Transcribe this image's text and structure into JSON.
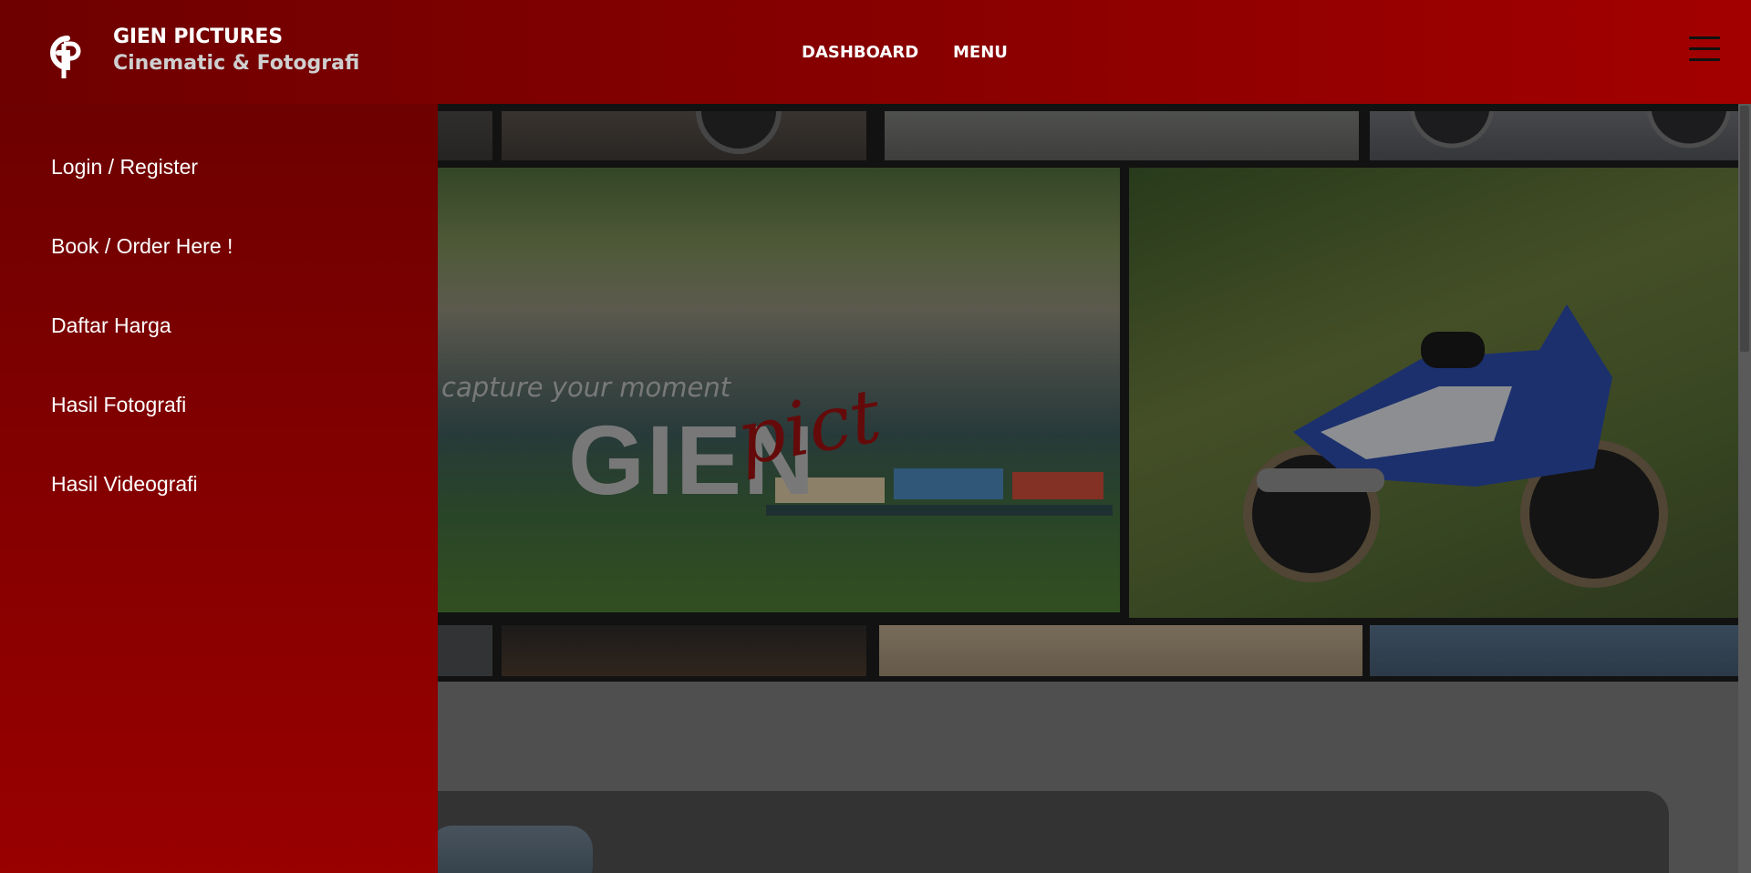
{
  "header": {
    "brand_title": "GIEN PICTURES",
    "brand_subtitle": "Cinematic & Fotografi",
    "nav": [
      "DASHBOARD",
      "MENU"
    ],
    "menu_icon": "hamburger-icon"
  },
  "hero": {
    "tagline": "capture your moment",
    "wordmark": "GIEN",
    "wordmark_script": "pict"
  },
  "sidebar": {
    "items": [
      {
        "label": "Login / Register"
      },
      {
        "label": "Book / Order Here !"
      },
      {
        "label": "Daftar Harga"
      },
      {
        "label": "Hasil Fotografi"
      },
      {
        "label": "Hasil Videografi"
      }
    ]
  },
  "colors": {
    "brand_red": "#8a0000",
    "script_red": "#9b1010",
    "text_white": "#ffffff"
  }
}
